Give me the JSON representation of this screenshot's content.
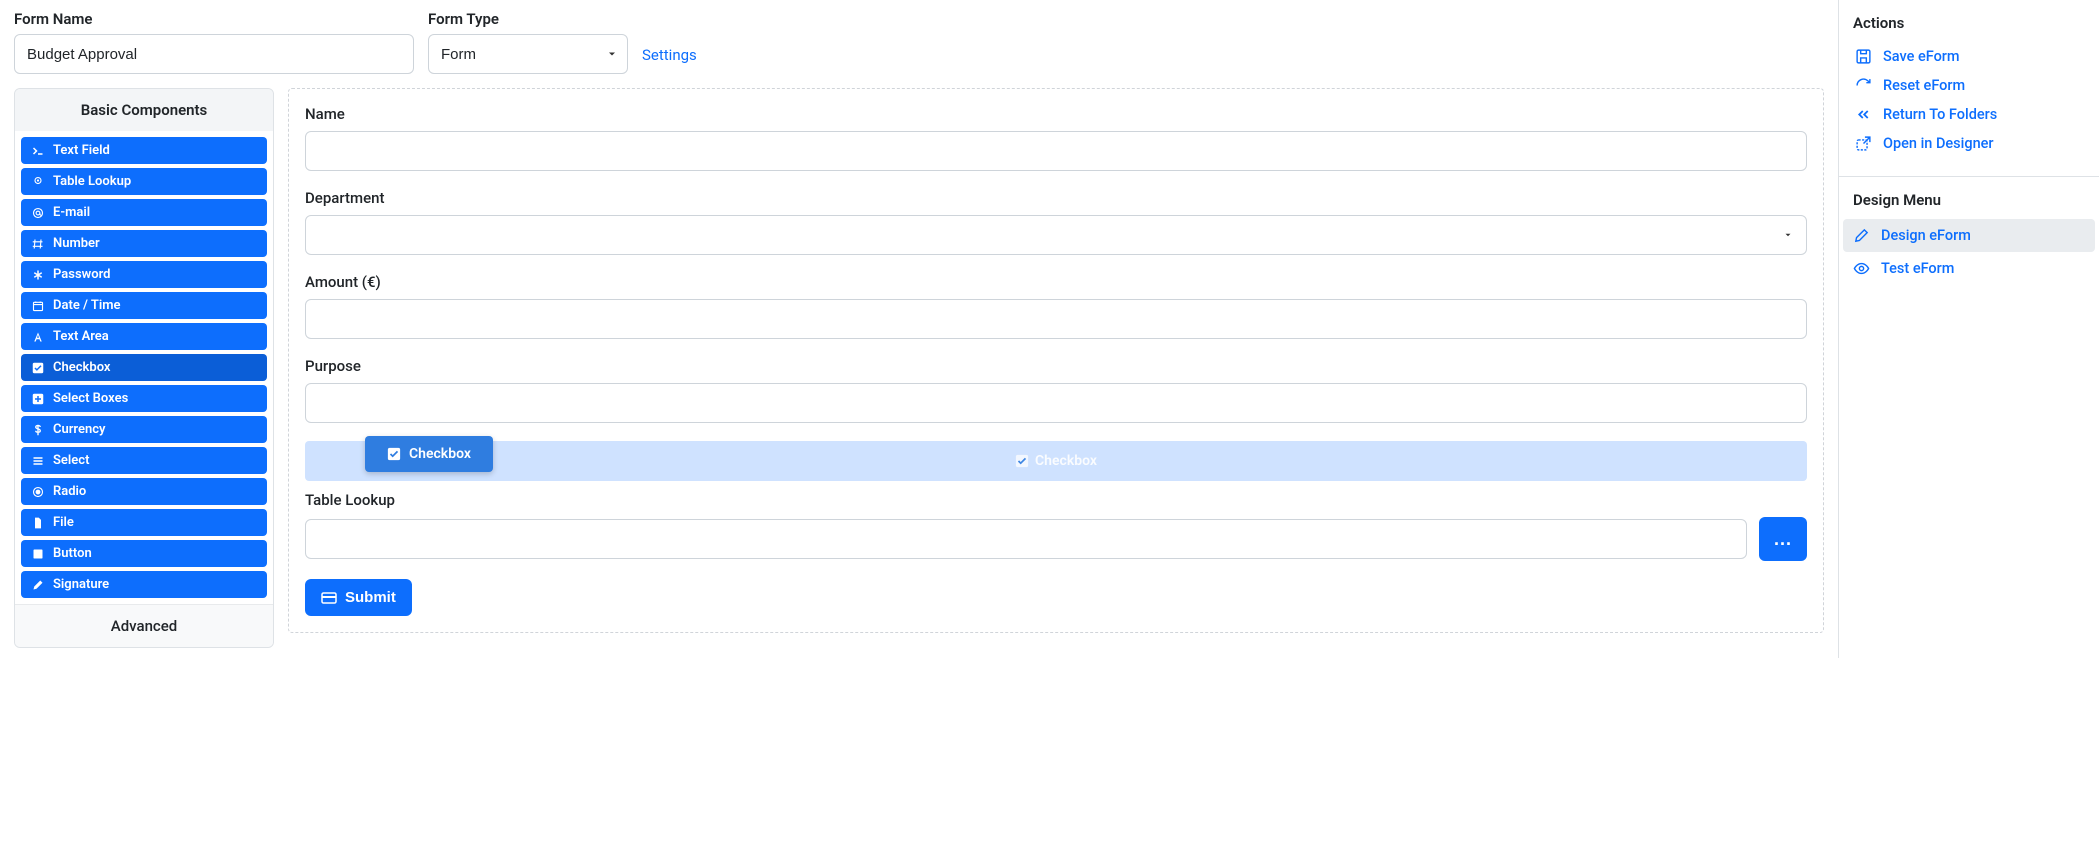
{
  "top": {
    "form_name_label": "Form Name",
    "form_name_value": "Budget Approval",
    "form_type_label": "Form Type",
    "form_type_value": "Form",
    "settings_link": "Settings"
  },
  "palette": {
    "header": "Basic Components",
    "items": [
      {
        "label": "Text Field",
        "icon": "terminal"
      },
      {
        "label": "Table Lookup",
        "icon": "pin"
      },
      {
        "label": "E-mail",
        "icon": "at"
      },
      {
        "label": "Number",
        "icon": "hash"
      },
      {
        "label": "Password",
        "icon": "asterisk"
      },
      {
        "label": "Date / Time",
        "icon": "calendar"
      },
      {
        "label": "Text Area",
        "icon": "font"
      },
      {
        "label": "Checkbox",
        "icon": "check-square",
        "hover": true
      },
      {
        "label": "Select Boxes",
        "icon": "plus-square"
      },
      {
        "label": "Currency",
        "icon": "dollar"
      },
      {
        "label": "Select",
        "icon": "list"
      },
      {
        "label": "Radio",
        "icon": "dot-circle"
      },
      {
        "label": "File",
        "icon": "file"
      },
      {
        "label": "Button",
        "icon": "square"
      },
      {
        "label": "Signature",
        "icon": "pen"
      }
    ],
    "footer": "Advanced"
  },
  "canvas": {
    "fields": [
      {
        "label": "Name",
        "type": "text"
      },
      {
        "label": "Department",
        "type": "select"
      },
      {
        "label": "Amount (€)",
        "type": "text"
      },
      {
        "label": "Purpose",
        "type": "text"
      }
    ],
    "drag_ghost_label": "Checkbox",
    "drag_chip_label": "Checkbox",
    "table_lookup_label": "Table Lookup",
    "lookup_button": "...",
    "submit_label": "Submit"
  },
  "right": {
    "actions_title": "Actions",
    "actions": [
      {
        "label": "Save eForm",
        "icon": "save"
      },
      {
        "label": "Reset eForm",
        "icon": "refresh"
      },
      {
        "label": "Return To Folders",
        "icon": "chevrons-left"
      },
      {
        "label": "Open in Designer",
        "icon": "open-external"
      }
    ],
    "design_title": "Design Menu",
    "design_items": [
      {
        "label": "Design eForm",
        "icon": "pencil",
        "active": true
      },
      {
        "label": "Test eForm",
        "icon": "eye"
      }
    ]
  }
}
